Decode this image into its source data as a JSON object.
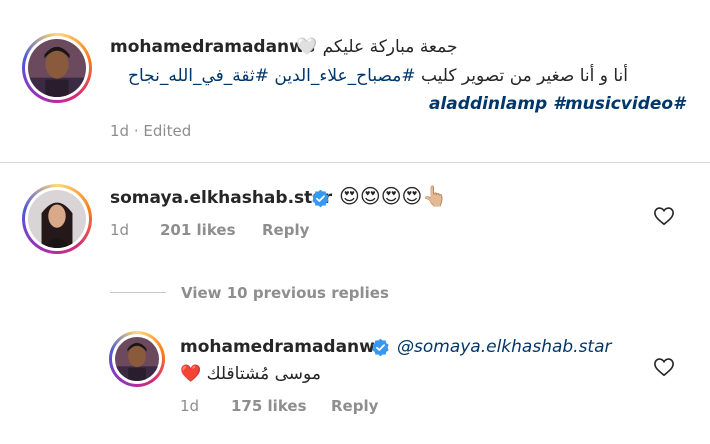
{
  "post": {
    "username": "mohamedramadanws",
    "caption_line1": "جمعة مباركة عليكم 🤍",
    "caption_line2_text": "أنا و أنا صغير من تصوير كليب",
    "caption_line2_tags": "#مصباح_علاء_الدين #ثقة_في_الله_نجاح",
    "caption_line3_tags": "aladdinlamp #musicvideo#",
    "time": "1d",
    "separator": "·",
    "edited": "Edited"
  },
  "comment1": {
    "username": "somaya.elkhashab.star",
    "text": "😍😍😍😍👆🏼",
    "time": "1d",
    "likes": "201 likes",
    "reply": "Reply"
  },
  "replies_toggle": {
    "label": "View 10 previous replies"
  },
  "reply1": {
    "username": "mohamedramadanws",
    "mention": "@somaya.elkhashab.star",
    "text": "موسى مُشتاقلك ❤️",
    "time": "1d",
    "likes": "175 likes",
    "reply": "Reply"
  },
  "icons": {
    "verified": "verified-badge-icon",
    "like": "heart-outline-icon"
  },
  "colors": {
    "verified": "#3897f0",
    "hashtag": "#00376b",
    "muted": "#8e8e8e"
  }
}
